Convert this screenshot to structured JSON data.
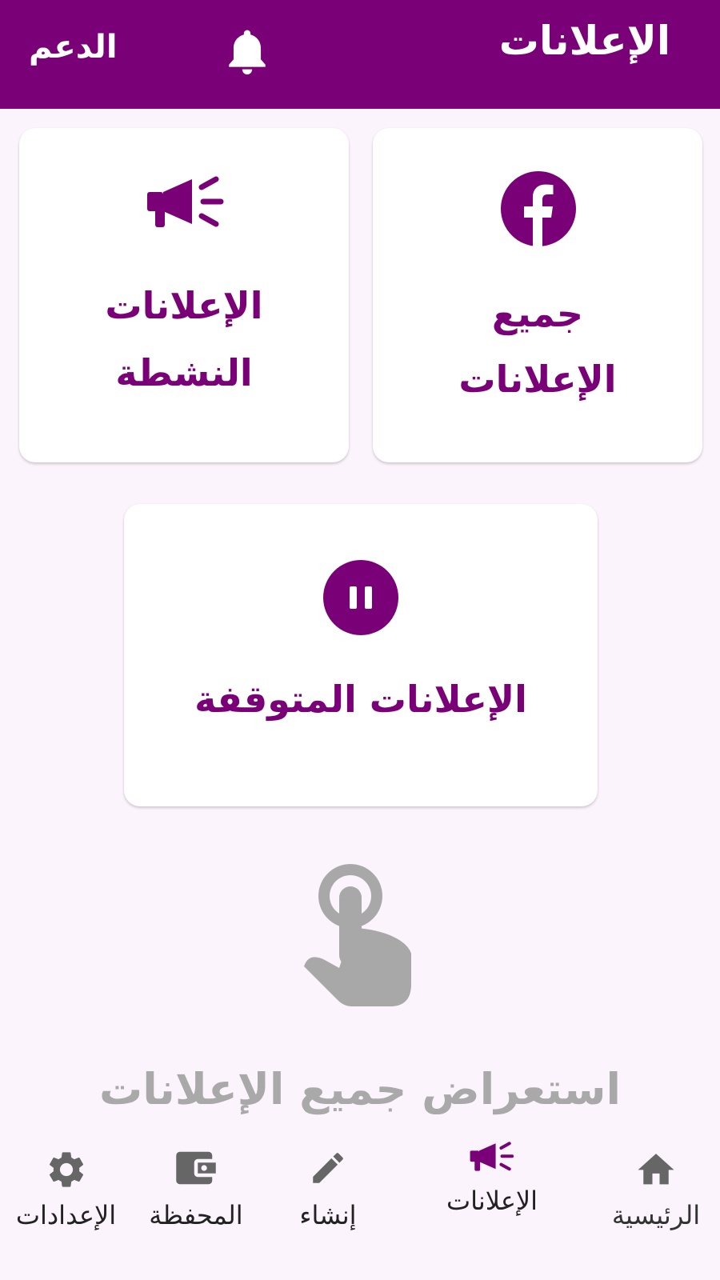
{
  "app_bar": {
    "title": "الإعلانات",
    "support_label": "الدعم",
    "bell_icon": "bell-icon",
    "color": "#7a0078"
  },
  "cards": {
    "all_ads": {
      "line1": "جميع",
      "line2": "الإعلانات",
      "icon": "facebook-icon"
    },
    "active_ads": {
      "line1": "الإعلانات",
      "line2": "النشطة",
      "icon": "megaphone-icon"
    },
    "paused_ads": {
      "label": "الإعلانات المتوقفة",
      "icon": "pause-icon"
    }
  },
  "hint": {
    "icon": "tap-hand-icon",
    "text": "استعراض جميع الإعلانات"
  },
  "bottom_nav": {
    "selected": "ads",
    "active_color": "#7a0078",
    "inactive_color": "#666666",
    "items": [
      {
        "id": "home",
        "label": "الرئيسية",
        "icon": "home-icon"
      },
      {
        "id": "ads",
        "label": "الإعلانات",
        "icon": "megaphone-icon"
      },
      {
        "id": "create",
        "label": "إنشاء",
        "icon": "pencil-icon"
      },
      {
        "id": "wallet",
        "label": "المحفظة",
        "icon": "wallet-icon"
      },
      {
        "id": "settings",
        "label": "الإعدادات",
        "icon": "gear-icon"
      }
    ]
  }
}
